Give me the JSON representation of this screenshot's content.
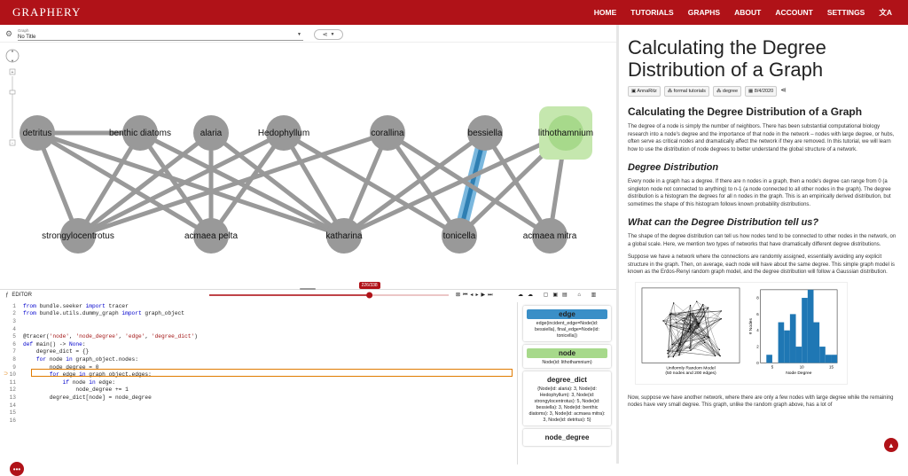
{
  "app": {
    "brand": "GRAPHERY"
  },
  "nav": [
    "HOME",
    "TUTORIALS",
    "GRAPHS",
    "ABOUT",
    "ACCOUNT",
    "SETTINGS"
  ],
  "graph_selector": {
    "label": "Graph",
    "value": "No Title"
  },
  "nodes": [
    {
      "id": "detritus",
      "label": "detritus"
    },
    {
      "id": "benthic",
      "label": "benthic diatoms"
    },
    {
      "id": "alaria",
      "label": "alaria"
    },
    {
      "id": "hedo",
      "label": "Hedophyllum"
    },
    {
      "id": "corallina",
      "label": "corallina"
    },
    {
      "id": "bessiella",
      "label": "bessiella"
    },
    {
      "id": "litho",
      "label": "lithothamnium"
    },
    {
      "id": "strongy",
      "label": "strongylocentrotus"
    },
    {
      "id": "acmaea_pelta",
      "label": "acmaea pelta"
    },
    {
      "id": "katharina",
      "label": "katharina"
    },
    {
      "id": "tonicella",
      "label": "tonicella"
    },
    {
      "id": "acmaea_mitra",
      "label": "acmaea mitra"
    }
  ],
  "editor": {
    "title": "EDITOR",
    "progress": "226/338",
    "progress_fraction": 0.669,
    "lines": [
      "from bundle.seeker import tracer",
      "from bundle.utils.dummy_graph import graph_object",
      "",
      "",
      "@tracer('node', 'node_degree', 'edge', 'degree_dict')",
      "def main() -> None:",
      "    degree_dict = {}",
      "    for node in graph_object.nodes:",
      "        node_degree = 0",
      "        for edge in graph_object.edges:",
      "            if node in edge:",
      "                node_degree += 1",
      "        degree_dict[node] = node_degree",
      "",
      "",
      ""
    ]
  },
  "variables": [
    {
      "name": "edge",
      "value": "edge(incident_edge=Node(id: bessiella), final_edge=Node(id: tonicella))",
      "color": "#3a8fc7"
    },
    {
      "name": "node",
      "value": "Node(id: lithothamnium)",
      "color": "#a7d98b"
    },
    {
      "name": "degree_dict",
      "value": "{Node(id: alaria): 3, Node(id: Hedophyllum): 3, Node(id: strongylocentrotus): 5, Node(id: bessiella): 3, Node(id: benthic diatoms): 3, Node(id: acmaea mitra): 3, Node(id: detritus): 5}",
      "color": ""
    },
    {
      "name": "node_degree",
      "value": "",
      "color": ""
    }
  ],
  "article": {
    "title": "Calculating the Degree Distribution of a Graph",
    "author": "AnnaRitz",
    "category": "formal tutorials",
    "tag": "degree",
    "date": "8/4/2020",
    "h2": "Calculating the Degree Distribution of a Graph",
    "p1": "The degree of a node is simply the number of neighbors. There has been substantial computational biology research into a node's degree and the importance of that node in the network – nodes with large degree, or hubs, often serve as critical nodes and dramatically affect the network if they are removed. In this tutorial, we will learn how to use the distribution of node degrees to better understand the global structure of a network.",
    "h3a": "Degree Distribution",
    "p2": "Every node in a graph has a degree. If there are n nodes in a graph, then a node's degree can range from 0 (a singleton node not connected to anything) to n-1 (a node connected to all other nodes in the graph). The degree distribution is a histogram the degrees for all n nodes in the graph. This is an empirically derived distribution, but sometimes the shape of this histogram follows known probability distributions.",
    "h3b": "What can the Degree Distribution tell us?",
    "p3": "The shape of the degree distribution can tell us how nodes tend to be connected to other nodes in the network, on a global scale. Here, we mention two types of networks that have dramatically different degree distributions.",
    "p4": "Suppose we have a network where the connections are randomly assigned, essentially avoiding any explicit structure in the graph. Then, on average, each node will have about the same degree. This simple graph model is known as the Erdos-Renyi random graph model, and the degree distribution will follow a Gaussian distribution.",
    "fig_caption": "Uniformly Random Model\n(50 nodes and 200 edges)",
    "fig_xlabel": "Node Degree",
    "fig_ylabel": "# Nodes",
    "p5": "Now, suppose we have another network, where there are only a few nodes with large degree while the remaining nodes have very small degree. This graph, unlike the random graph above, has a lot of"
  },
  "hist": {
    "x": [
      4,
      5,
      6,
      7,
      8,
      9,
      10,
      11,
      12,
      13,
      14,
      15
    ],
    "values": [
      1,
      0,
      5,
      4,
      6,
      2,
      8,
      9,
      5,
      2,
      1,
      1
    ],
    "xticks": [
      "5",
      "10",
      "15"
    ],
    "yticks": [
      "0",
      "2",
      "4",
      "6",
      "8"
    ]
  }
}
